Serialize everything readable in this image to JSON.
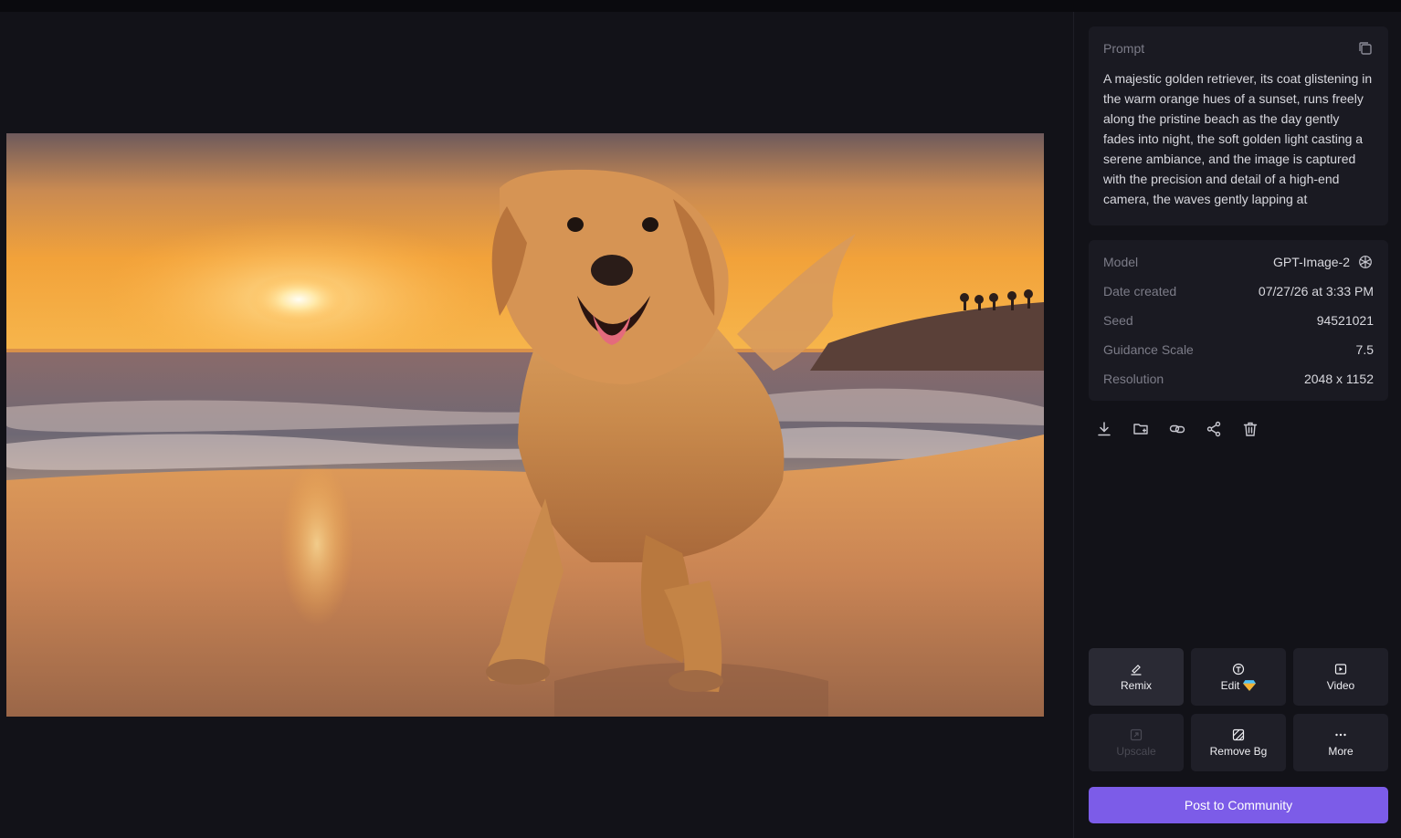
{
  "prompt": {
    "label": "Prompt",
    "text": "A majestic golden retriever, its coat glistening in the warm orange hues of a sunset, runs freely along the pristine beach as the day gently fades into night, the soft golden light casting a serene ambiance, and the image is captured with the precision and detail of a high-end camera, the waves gently lapping at",
    "copy_icon": "copy-icon"
  },
  "meta": {
    "model_label": "Model",
    "model_value": "GPT-Image-2",
    "model_icon": "openai-icon",
    "date_label": "Date created",
    "date_value": "07/27/26 at 3:33 PM",
    "seed_label": "Seed",
    "seed_value": "94521021",
    "guidance_label": "Guidance Scale",
    "guidance_value": "7.5",
    "resolution_label": "Resolution",
    "resolution_value": "2048 x 1152"
  },
  "toolbar_icons": [
    "download-icon",
    "add-to-folder-icon",
    "link-icon",
    "share-icon",
    "trash-icon"
  ],
  "actions": {
    "remix": "Remix",
    "edit": "Edit",
    "video": "Video",
    "upscale": "Upscale",
    "remove_bg": "Remove Bg",
    "more": "More"
  },
  "post_button": "Post to Community",
  "colors": {
    "accent": "#7c5ce8",
    "background": "#121218",
    "card": "#1a1a22"
  }
}
